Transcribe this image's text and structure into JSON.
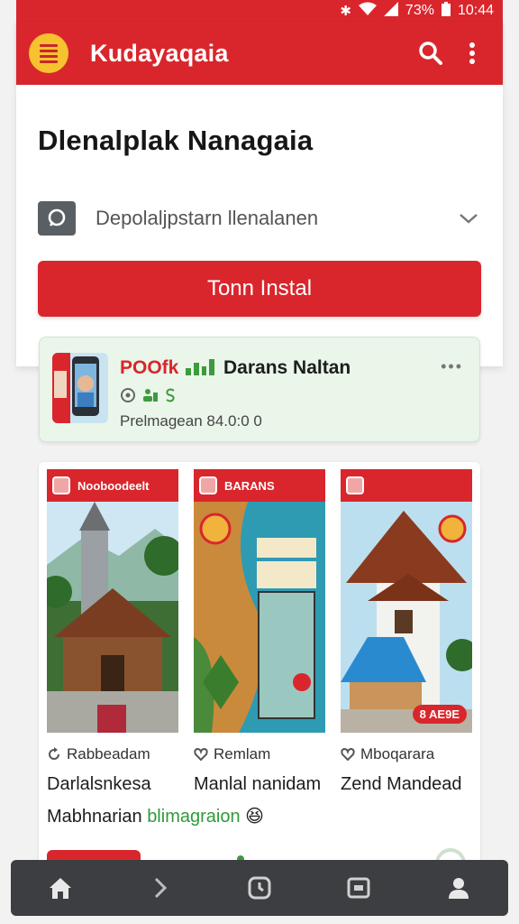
{
  "status_bar": {
    "bluetooth_icon": "bluetooth-icon",
    "wifi_icon": "wifi-icon",
    "signal_icon": "signal-icon",
    "battery_pct": "73%",
    "battery_icon": "battery-icon",
    "time": "10:44"
  },
  "app_bar": {
    "menu_icon": "menu-icon",
    "title": "Kudayaqaia",
    "search_icon": "search-icon",
    "more_icon": "more-vertical-icon",
    "color": "#d9262c",
    "accent": "#f7c22f"
  },
  "page": {
    "title": "Dlenalplak Nanagaia",
    "select_icon": "chat-icon",
    "select_text": "Depolaljpstarn llenalanen",
    "select_chevron": "chevron-down-icon",
    "primary_button": "Tonn Instal"
  },
  "app_card": {
    "badge": "POOfk",
    "chart_icon": "bar-chart-icon",
    "name": "Darans Naltan",
    "more": "•••",
    "meta": "Prelmagean 84.0:0 0",
    "meta_icons": [
      "settings-icon",
      "people-icon",
      "dollar-icon"
    ],
    "background": "#eaf6ea"
  },
  "gallery": [
    {
      "header_title": "Nooboodeelt",
      "meta_icon": "refresh-icon",
      "meta": "Rabbeadam",
      "title": "Darlalsnkesa"
    },
    {
      "header_title": "BARANS",
      "meta_icon": "heart-icon",
      "meta": "Remlam",
      "title": "Manlal nanidam"
    },
    {
      "header_title": "",
      "meta_icon": "heart-icon",
      "meta": "Mboqarara",
      "title": "Zend Mandead",
      "price": "8 AE9E"
    }
  ],
  "gallery_sub": {
    "text": "Mabhnarian",
    "highlight": "blimagraion",
    "emoji": "😆"
  },
  "bottom_nav": {
    "items": [
      "home-icon",
      "forward-icon",
      "clock-icon",
      "window-icon",
      "profile-icon"
    ]
  }
}
